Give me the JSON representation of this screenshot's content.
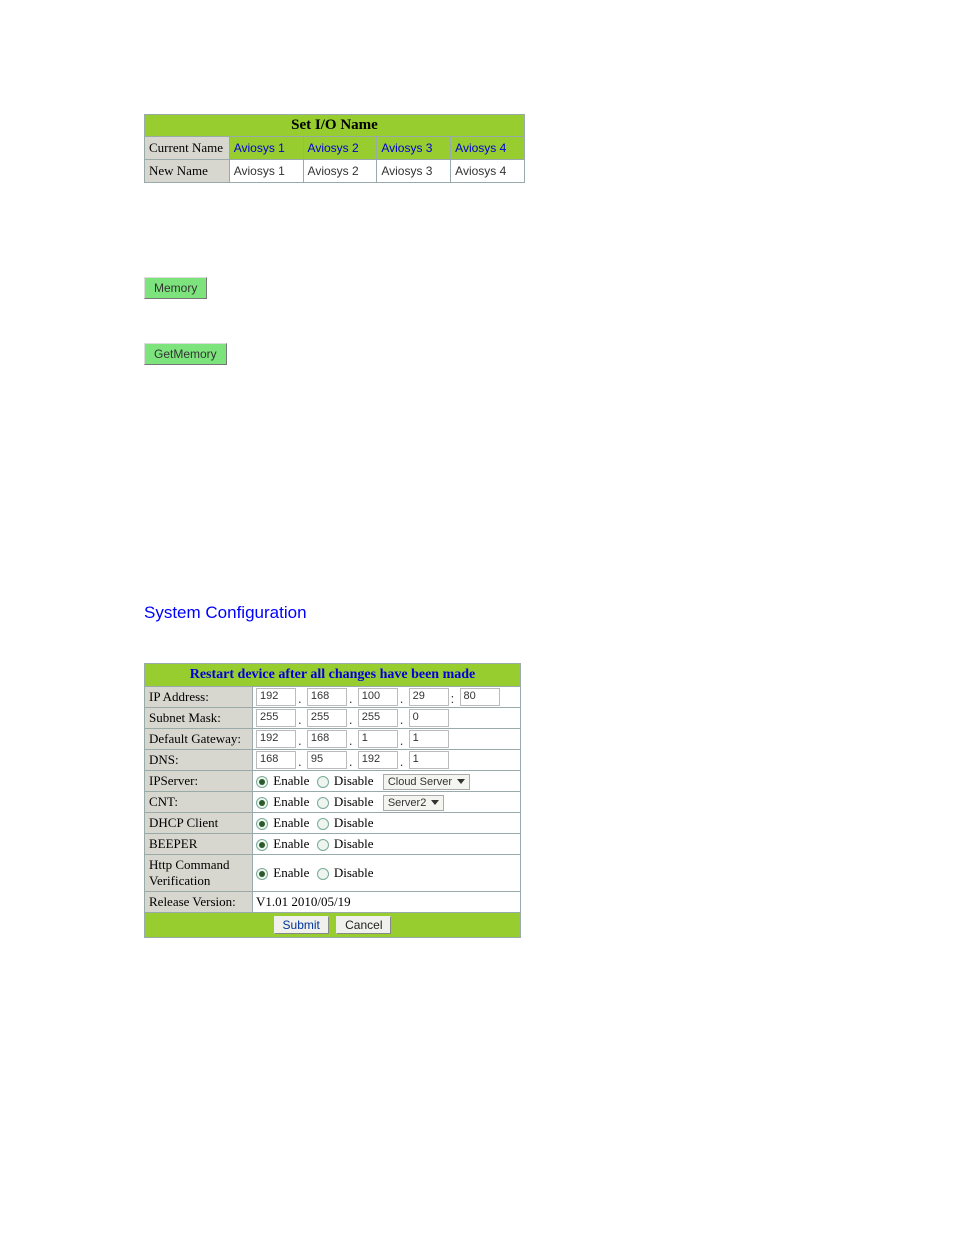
{
  "io_table": {
    "title": "Set I/O Name",
    "current_label": "Current Name",
    "new_label": "New Name",
    "current": [
      "Aviosys 1",
      "Aviosys 2",
      "Aviosys 3",
      "Aviosys 4"
    ],
    "new_": [
      "Aviosys 1",
      "Aviosys 2",
      "Aviosys 3",
      "Aviosys 4"
    ]
  },
  "buttons": {
    "memory": "Memory",
    "get_memory": "GetMemory"
  },
  "sysconf": {
    "heading": "System Configuration",
    "banner": "Restart device after all changes have been made",
    "rows": {
      "ip_label": "IP Address:",
      "ip": [
        "192",
        "168",
        "100",
        "29",
        "80"
      ],
      "subnet_label": "Subnet Mask:",
      "subnet": [
        "255",
        "255",
        "255",
        "0"
      ],
      "gw_label": "Default Gateway:",
      "gw": [
        "192",
        "168",
        "1",
        "1"
      ],
      "dns_label": "DNS:",
      "dns": [
        "168",
        "95",
        "192",
        "1"
      ],
      "ipserver_label": "IPServer:",
      "cnt_label": "CNT:",
      "dhcp_label": "DHCP Client",
      "beeper_label": "BEEPER",
      "http_label": "Http Command Verification",
      "release_label": "Release Version:",
      "release_value": "V1.01 2010/05/19"
    },
    "enable": "Enable",
    "disable": "Disable",
    "ipserver_dropdown": "Cloud Server",
    "cnt_dropdown": "Server2",
    "submit": "Submit",
    "cancel": "Cancel"
  }
}
